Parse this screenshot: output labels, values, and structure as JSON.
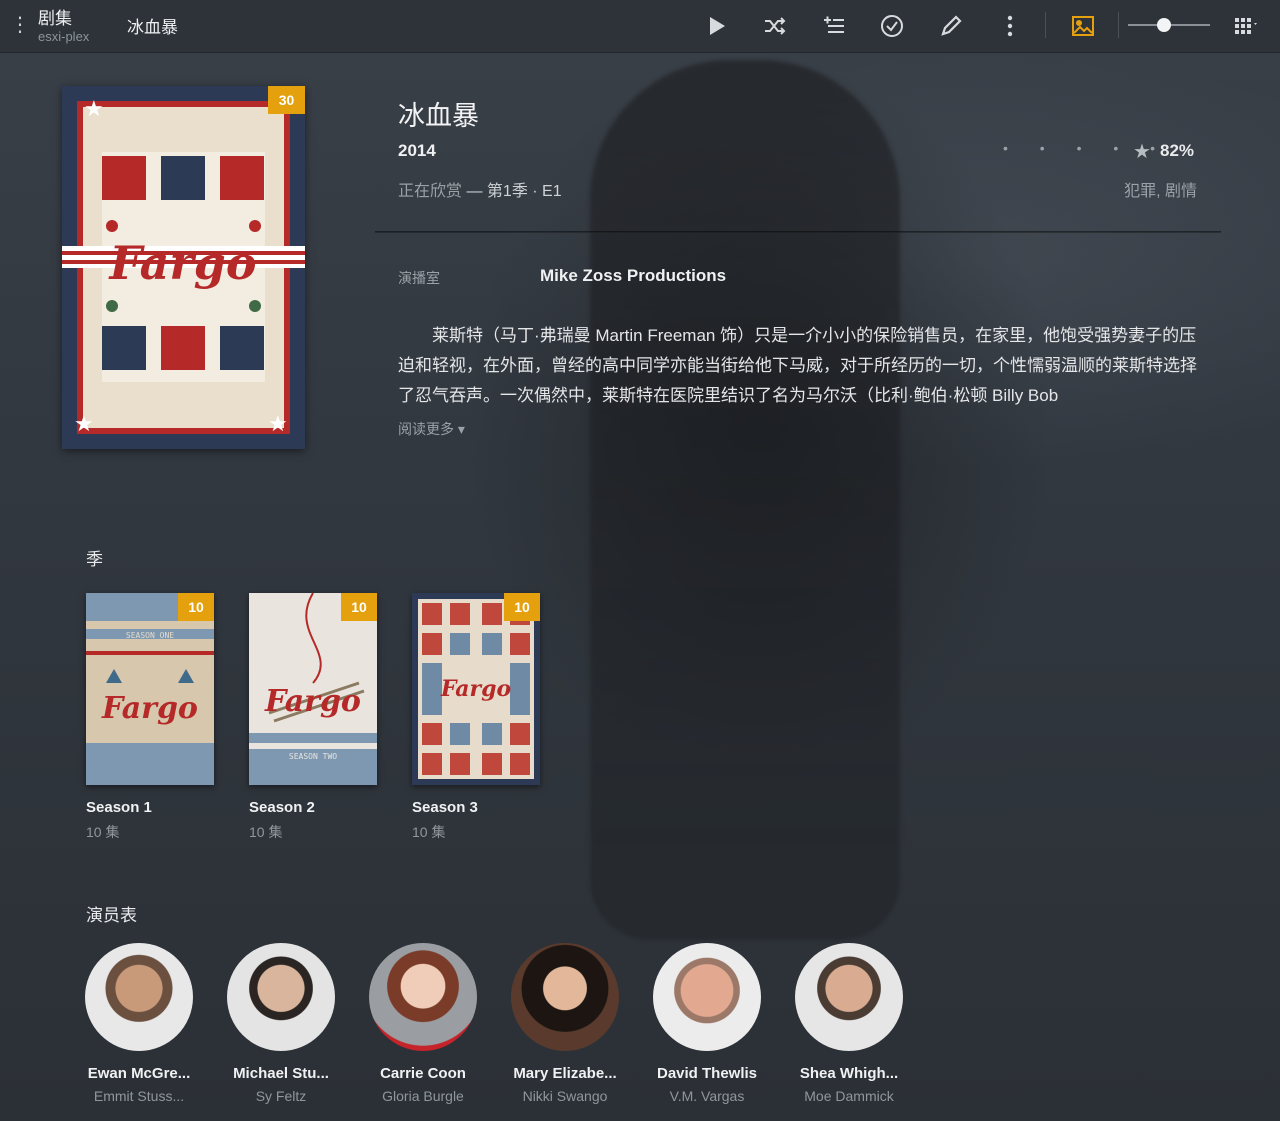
{
  "topbar": {
    "library_title": "剧集",
    "server_name": "esxi-plex",
    "crumb": "冰血暴",
    "icons": [
      "play-icon",
      "shuffle-icon",
      "add-to-playlist-icon",
      "mark-watched-icon",
      "edit-icon",
      "more-icon",
      "background-art-icon",
      "grid-icon"
    ],
    "accent": "#e5a00d"
  },
  "poster": {
    "badge": "30",
    "logo_text": "Fargo"
  },
  "show": {
    "title": "冰血暴",
    "year": "2014",
    "watching_label": "正在欣赏",
    "watching_episode": "— 第1季 · E1",
    "rating_dots": "• • • • •",
    "rating_value": "82%",
    "genres": "犯罪, 剧情",
    "studio_label": "演播室",
    "studio": "Mike Zoss Productions",
    "summary": "莱斯特（马丁·弗瑞曼 Martin Freeman 饰）只是一介小小的保险销售员，在家里，他饱受强势妻子的压迫和轻视，在外面，曾经的高中同学亦能当街给他下马威，对于所经历的一切，个性懦弱温顺的莱斯特选择了忍气吞声。一次偶然中，莱斯特在医院里结识了名为马尔沃（比利·鲍伯·松顿 Billy Bob",
    "read_more": "阅读更多 ▾"
  },
  "seasons_section": {
    "title": "季",
    "items": [
      {
        "title": "Season 1",
        "count": "10 集",
        "badge": "10",
        "art_text": "Fargo",
        "art_caption": "SEASON ONE"
      },
      {
        "title": "Season 2",
        "count": "10 集",
        "badge": "10",
        "art_text": "Fargo",
        "art_caption": "SEASON TWO"
      },
      {
        "title": "Season 3",
        "count": "10 集",
        "badge": "10",
        "art_text": "Fargo",
        "art_caption": ""
      }
    ]
  },
  "cast_section": {
    "title": "演员表",
    "items": [
      {
        "actor": "Ewan McGre...",
        "role": "Emmit Stuss..."
      },
      {
        "actor": "Michael Stu...",
        "role": "Sy Feltz"
      },
      {
        "actor": "Carrie Coon",
        "role": "Gloria Burgle"
      },
      {
        "actor": "Mary Elizabe...",
        "role": "Nikki Swango"
      },
      {
        "actor": "David Thewlis",
        "role": "V.M. Vargas"
      },
      {
        "actor": "Shea Whigh...",
        "role": "Moe Dammick"
      }
    ]
  }
}
